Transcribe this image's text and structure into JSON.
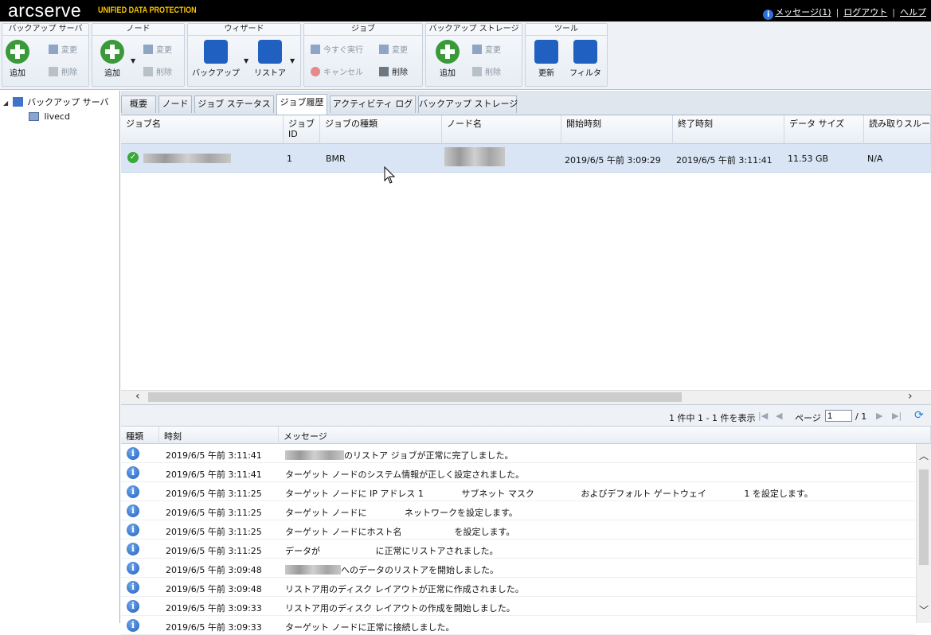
{
  "header": {
    "logo": "arcserve",
    "logo_sub": "UNIFIED DATA PROTECTION",
    "links": {
      "messages": "メッセージ(1)",
      "logout": "ログアウト",
      "help": "ヘルプ"
    }
  },
  "ribbon": {
    "backup_server": {
      "title": "バックアップ サーバ",
      "add": "追加",
      "modify": "変更",
      "delete": "削除"
    },
    "node": {
      "title": "ノード",
      "add": "追加",
      "modify": "変更",
      "delete": "削除"
    },
    "wizard": {
      "title": "ウィザード",
      "backup": "バックアップ",
      "restore": "リストア"
    },
    "job": {
      "title": "ジョブ",
      "run_now": "今すぐ実行",
      "modify": "変更",
      "cancel": "キャンセル",
      "delete": "削除"
    },
    "backup_storage": {
      "title": "バックアップ ストレージ",
      "add": "追加",
      "modify": "変更",
      "delete": "削除"
    },
    "tools": {
      "title": "ツール",
      "refresh": "更新",
      "filter": "フィルタ"
    }
  },
  "tree": {
    "root": "バックアップ サーバ",
    "child": "livecd"
  },
  "tabs": [
    "概要",
    "ノード",
    "ジョブ ステータス",
    "ジョブ履歴",
    "アクティビティ ログ",
    "バックアップ ストレージ"
  ],
  "active_tab": "ジョブ履歴",
  "job_grid": {
    "columns": [
      "ジョブ名",
      "ジョブ ID",
      "ジョブの種類",
      "ノード名",
      "開始時刻",
      "終了時刻",
      "データ サイズ",
      "読み取りスループ"
    ],
    "rows": [
      {
        "job_id": "1",
        "type": "BMR",
        "start": "2019/6/5 午前 3:09:29",
        "end": "2019/6/5 午前 3:11:41",
        "size": "11.53 GB",
        "throughput": "N/A"
      }
    ]
  },
  "pager": {
    "summary": "1 件中 1 - 1 件を表示",
    "page_label": "ページ",
    "page_value": "1",
    "page_total": "/ 1"
  },
  "log": {
    "columns": [
      "種類",
      "時刻",
      "メッセージ"
    ],
    "rows": [
      {
        "time": "2019/6/5 午前 3:11:41",
        "msg": "のリストア ジョブが正常に完了しました。"
      },
      {
        "time": "2019/6/5 午前 3:11:41",
        "msg": "ターゲット ノードのシステム情報が正しく設定されました。"
      },
      {
        "time": "2019/6/5 午前 3:11:25",
        "msg": "ターゲット ノードに IP アドレス 1　　　　 サブネット マスク　　　　　 およびデフォルト ゲートウェイ　　　　 1 を設定します。"
      },
      {
        "time": "2019/6/5 午前 3:11:25",
        "msg": "ターゲット ノードに　　　　 ネットワークを設定します。"
      },
      {
        "time": "2019/6/5 午前 3:11:25",
        "msg": "ターゲット ノードにホスト名　　　　　　を設定します。"
      },
      {
        "time": "2019/6/5 午前 3:11:25",
        "msg": "データが　　　　　　 に正常にリストアされました。"
      },
      {
        "time": "2019/6/5 午前 3:09:48",
        "msg": "へのデータのリストアを開始しました。"
      },
      {
        "time": "2019/6/5 午前 3:09:48",
        "msg": "リストア用のディスク レイアウトが正常に作成されました。"
      },
      {
        "time": "2019/6/5 午前 3:09:33",
        "msg": "リストア用のディスク レイアウトの作成を開始しました。"
      },
      {
        "time": "2019/6/5 午前 3:09:33",
        "msg": "ターゲット ノードに正常に接続しました。"
      }
    ]
  }
}
